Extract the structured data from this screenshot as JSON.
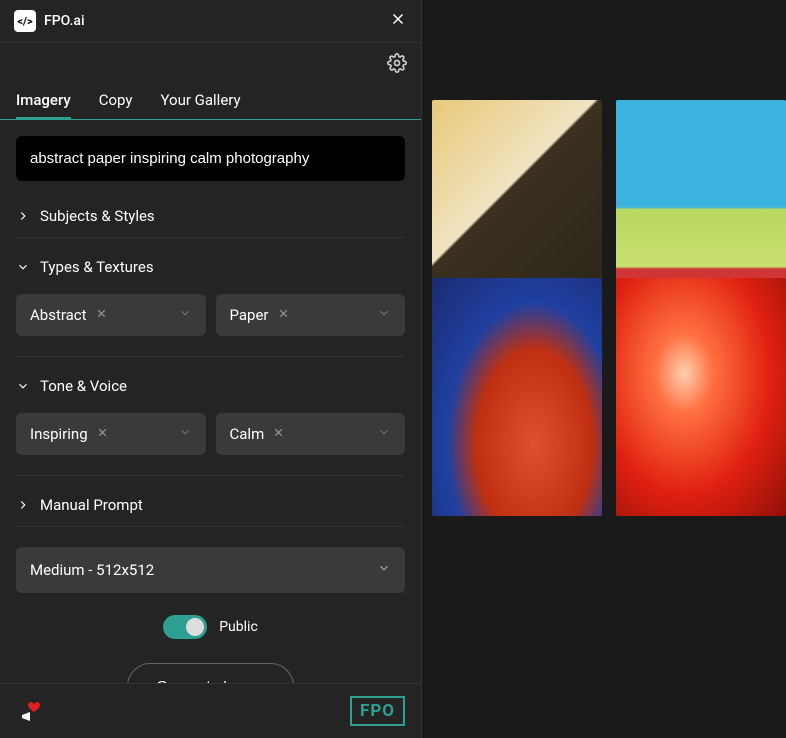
{
  "app": {
    "name": "FPO.ai"
  },
  "tabs": {
    "imagery": "Imagery",
    "copy": "Copy",
    "gallery": "Your Gallery"
  },
  "prompt": {
    "value": "abstract paper inspiring calm photography"
  },
  "sections": {
    "subjects_styles": "Subjects & Styles",
    "types_textures": "Types & Textures",
    "tone_voice": "Tone & Voice",
    "manual_prompt": "Manual Prompt"
  },
  "chips": {
    "abstract": "Abstract",
    "paper": "Paper",
    "inspiring": "Inspiring",
    "calm": "Calm"
  },
  "size": {
    "selected": "Medium - 512x512"
  },
  "toggle": {
    "public_label": "Public"
  },
  "buttons": {
    "generate": "Generate Image"
  },
  "footer": {
    "badge": "FPO"
  }
}
